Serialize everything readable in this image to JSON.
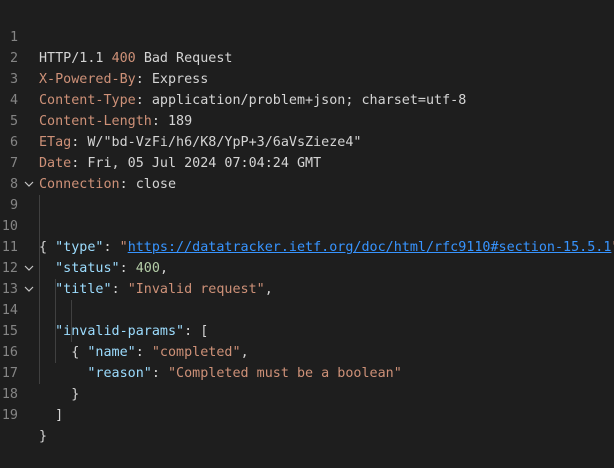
{
  "status_line": {
    "protocol": "HTTP/1.1",
    "code": "400",
    "reason": "Bad Request"
  },
  "headers": [
    {
      "name": "X-Powered-By",
      "value": "Express"
    },
    {
      "name": "Content-Type",
      "value": "application/problem+json; charset=utf-8"
    },
    {
      "name": "Content-Length",
      "value": "189"
    },
    {
      "name": "ETag",
      "value": "W/\"bd-VzFi/h6/K8/YpP+3/6aVsZieze4\""
    },
    {
      "name": "Date",
      "value": "Fri, 05 Jul 2024 07:04:24 GMT"
    },
    {
      "name": "Connection",
      "value": "close"
    }
  ],
  "body": {
    "type_key": "\"type\"",
    "type_url": "https://datatracker.ietf.org/doc/html/rfc9110#section-15.5.1",
    "status_key": "\"status\"",
    "status_value": "400",
    "title_key": "\"title\"",
    "title_value": "\"Invalid request\"",
    "params_key": "\"invalid-params\"",
    "name_key": "\"name\"",
    "name_value": "\"completed\"",
    "reason_key": "\"reason\"",
    "reason_value": "\"Completed must be a boolean\""
  },
  "line_numbers": [
    "1",
    "2",
    "3",
    "4",
    "5",
    "6",
    "7",
    "8",
    "9",
    "10",
    "11",
    "12",
    "13",
    "14",
    "15",
    "16",
    "17",
    "18",
    "19"
  ],
  "colors": {
    "background": "#1e1e1e",
    "line_number": "#858585",
    "header_name": "#ce9178",
    "json_key": "#9cdcfe",
    "json_string": "#ce9178",
    "json_number": "#b5cea8",
    "link": "#3794ff"
  },
  "icons": {
    "fold": "chevron-down-icon"
  }
}
